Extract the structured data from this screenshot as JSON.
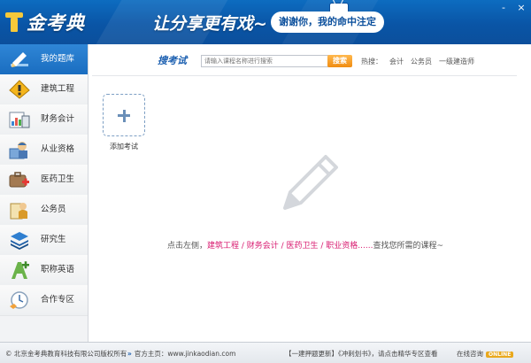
{
  "app": {
    "name": "金考典",
    "slogan": "让分享更有戏~",
    "bubble": "谢谢你，我的命中注定",
    "window": {
      "minimize": "-",
      "close": "×"
    }
  },
  "sidebar": {
    "items": [
      {
        "label": "我的题库",
        "icon": "edit-pen-icon",
        "active": true
      },
      {
        "label": "建筑工程",
        "icon": "construction-sign-icon",
        "active": false
      },
      {
        "label": "财务会计",
        "icon": "calculator-chart-icon",
        "active": false
      },
      {
        "label": "从业资格",
        "icon": "worker-certificate-icon",
        "active": false
      },
      {
        "label": "医药卫生",
        "icon": "medical-kit-icon",
        "active": false
      },
      {
        "label": "公务员",
        "icon": "civil-servant-icon",
        "active": false
      },
      {
        "label": "研究生",
        "icon": "layers-stack-icon",
        "active": false
      },
      {
        "label": "职称英语",
        "icon": "english-letter-icon",
        "active": false
      },
      {
        "label": "合作专区",
        "icon": "clock-handshake-icon",
        "active": false
      }
    ]
  },
  "search": {
    "label": "搜考试",
    "placeholder": "请输入课程名称进行搜索",
    "button": "搜索",
    "hot_label": "热搜：",
    "hot_items": [
      "会计",
      "公务员",
      "一级建造师"
    ]
  },
  "main": {
    "add_exam_label": "添加考试",
    "hint_prefix": "点击左侧，",
    "hint_highlight": "建筑工程 / 财务会计 / 医药卫生 / 职业资格......",
    "hint_suffix": "查找您所需的课程~"
  },
  "footer": {
    "copyright": "© 北京金考典教育科技有限公司版权所有",
    "site_label": "官方主页：",
    "site_url": "www.jinkaodian.com",
    "update_link": "【一建押题更新】",
    "plan_link": "《冲刺划书》",
    "plan_suffix": "，请点击精华专区查看",
    "consult": "在线咨询",
    "online_badge": "ONLINE"
  },
  "colors": {
    "header_blue": "#0b4f9c",
    "active_nav": "#1a6dc0",
    "search_button": "#f08c11",
    "hint_highlight": "#d8196f"
  }
}
